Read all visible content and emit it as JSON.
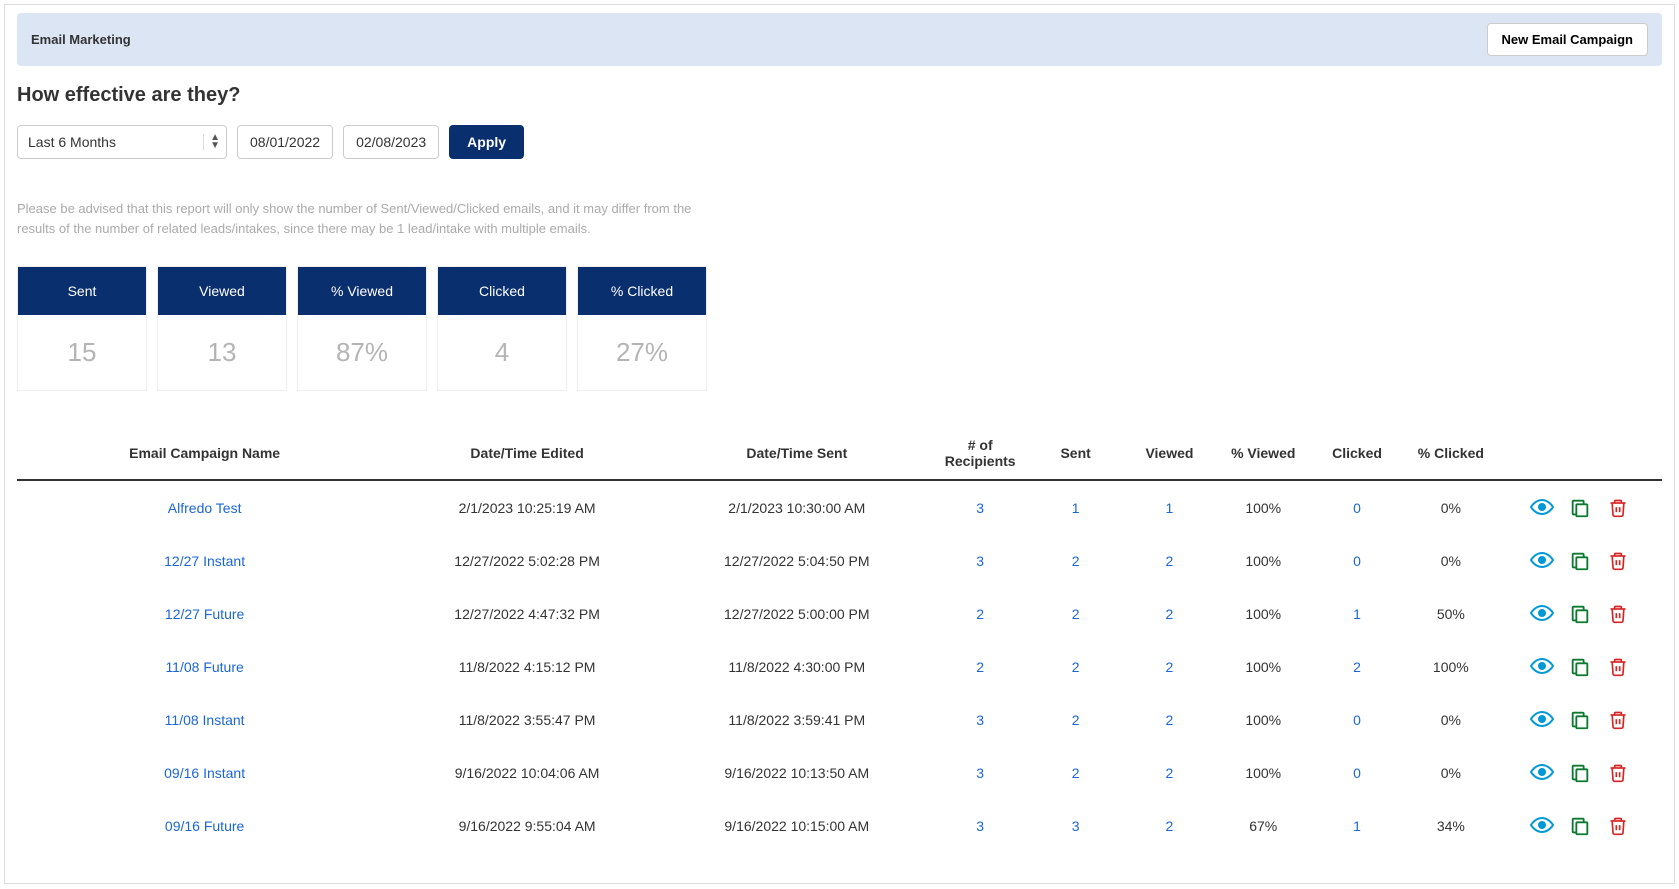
{
  "header": {
    "title": "Email Marketing",
    "new_button": "New Email Campaign"
  },
  "page_title": "How effective are they?",
  "filters": {
    "range_select": "Last 6 Months",
    "date_from": "08/01/2022",
    "date_to": "02/08/2023",
    "apply_button": "Apply"
  },
  "disclaimer": "Please be advised that this report will only show the number of Sent/Viewed/Clicked emails, and it may differ from the results of the number of related leads/intakes, since there may be 1 lead/intake with multiple emails.",
  "stats": [
    {
      "label": "Sent",
      "value": "15"
    },
    {
      "label": "Viewed",
      "value": "13"
    },
    {
      "label": "% Viewed",
      "value": "87%"
    },
    {
      "label": "Clicked",
      "value": "4"
    },
    {
      "label": "% Clicked",
      "value": "27%"
    }
  ],
  "table": {
    "headers": {
      "name": "Email Campaign Name",
      "edited": "Date/Time Edited",
      "sent_dt": "Date/Time Sent",
      "recipients": "# of Recipients",
      "sent": "Sent",
      "viewed": "Viewed",
      "pct_viewed": "% Viewed",
      "clicked": "Clicked",
      "pct_clicked": "% Clicked"
    },
    "rows": [
      {
        "name": "Alfredo Test",
        "edited": "2/1/2023 10:25:19 AM",
        "sent_dt": "2/1/2023 10:30:00 AM",
        "recipients": "3",
        "sent": "1",
        "viewed": "1",
        "pct_viewed": "100%",
        "clicked": "0",
        "pct_clicked": "0%"
      },
      {
        "name": "12/27 Instant",
        "edited": "12/27/2022 5:02:28 PM",
        "sent_dt": "12/27/2022 5:04:50 PM",
        "recipients": "3",
        "sent": "2",
        "viewed": "2",
        "pct_viewed": "100%",
        "clicked": "0",
        "pct_clicked": "0%"
      },
      {
        "name": "12/27 Future",
        "edited": "12/27/2022 4:47:32 PM",
        "sent_dt": "12/27/2022 5:00:00 PM",
        "recipients": "2",
        "sent": "2",
        "viewed": "2",
        "pct_viewed": "100%",
        "clicked": "1",
        "pct_clicked": "50%"
      },
      {
        "name": "11/08 Future",
        "edited": "11/8/2022 4:15:12 PM",
        "sent_dt": "11/8/2022 4:30:00 PM",
        "recipients": "2",
        "sent": "2",
        "viewed": "2",
        "pct_viewed": "100%",
        "clicked": "2",
        "pct_clicked": "100%"
      },
      {
        "name": "11/08 Instant",
        "edited": "11/8/2022 3:55:47 PM",
        "sent_dt": "11/8/2022 3:59:41 PM",
        "recipients": "3",
        "sent": "2",
        "viewed": "2",
        "pct_viewed": "100%",
        "clicked": "0",
        "pct_clicked": "0%"
      },
      {
        "name": "09/16 Instant",
        "edited": "9/16/2022 10:04:06 AM",
        "sent_dt": "9/16/2022 10:13:50 AM",
        "recipients": "3",
        "sent": "2",
        "viewed": "2",
        "pct_viewed": "100%",
        "clicked": "0",
        "pct_clicked": "0%"
      },
      {
        "name": "09/16 Future",
        "edited": "9/16/2022 9:55:04 AM",
        "sent_dt": "9/16/2022 10:15:00 AM",
        "recipients": "3",
        "sent": "3",
        "viewed": "2",
        "pct_viewed": "67%",
        "clicked": "1",
        "pct_clicked": "34%"
      }
    ]
  }
}
